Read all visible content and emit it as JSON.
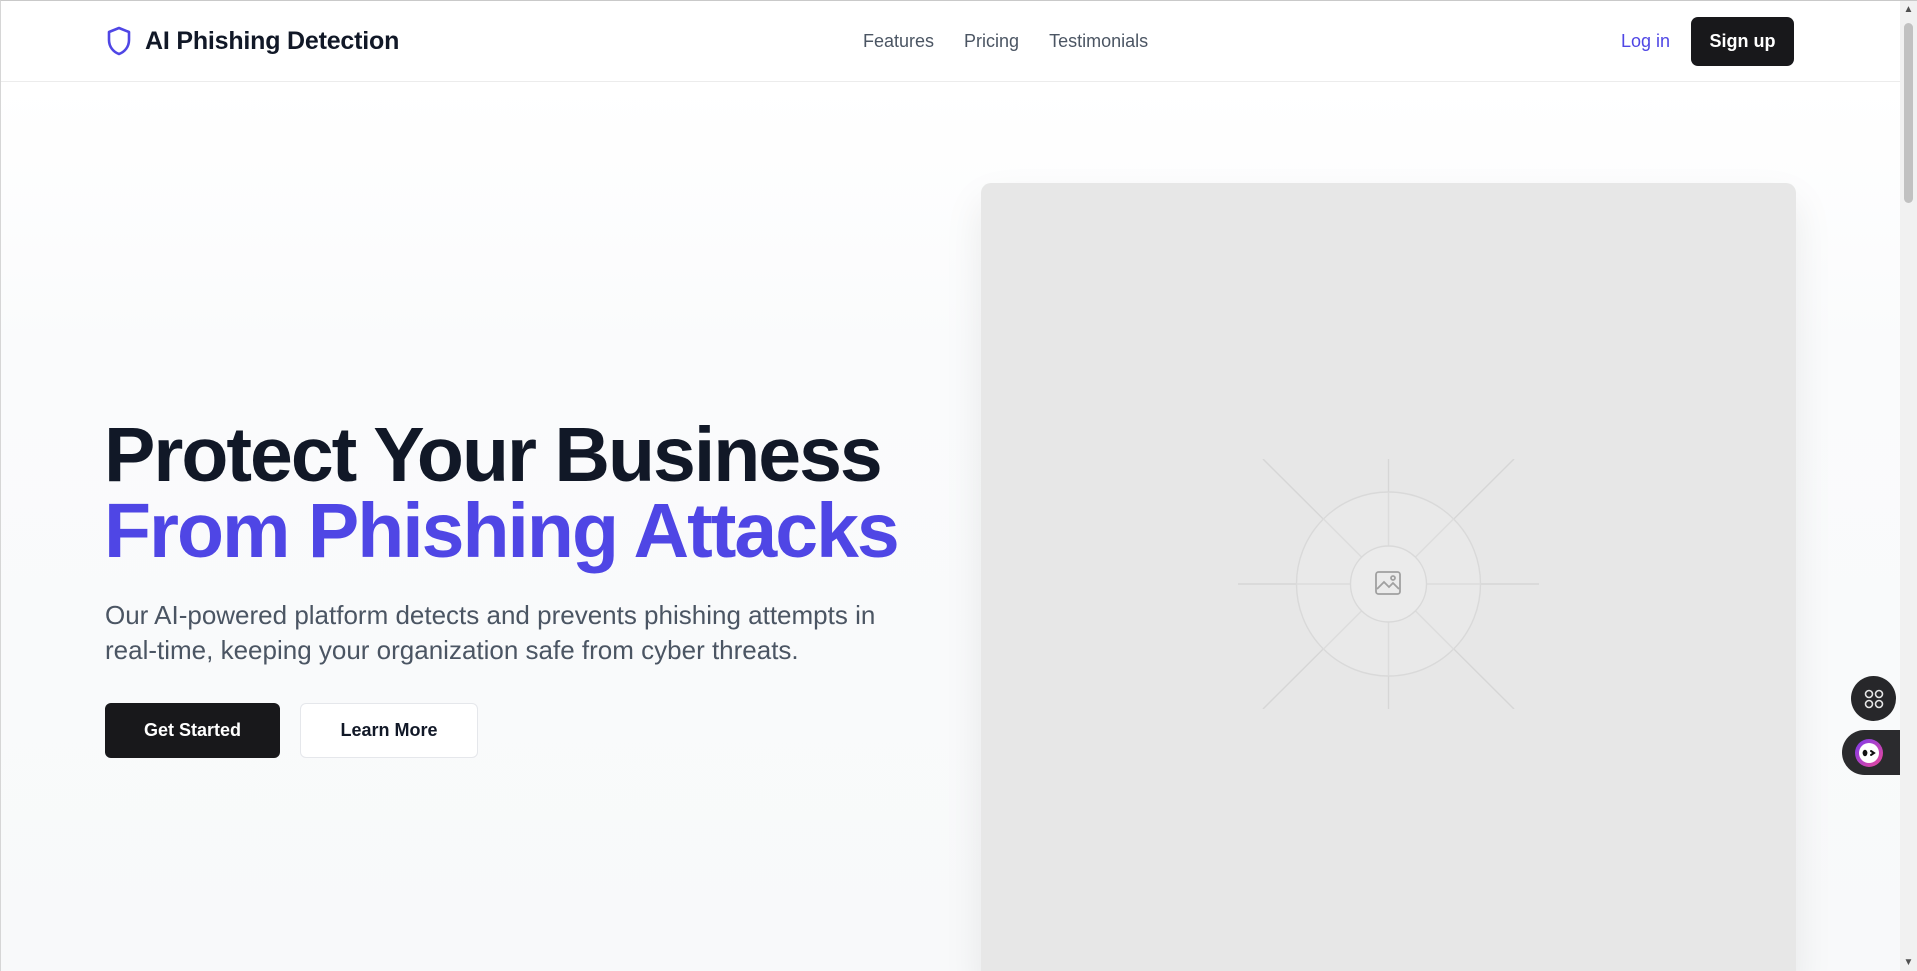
{
  "header": {
    "brand_name": "AI Phishing Detection",
    "brand_icon": "shield-icon",
    "nav": [
      {
        "label": "Features"
      },
      {
        "label": "Pricing"
      },
      {
        "label": "Testimonials"
      }
    ],
    "login_label": "Log in",
    "signup_label": "Sign up"
  },
  "hero": {
    "title_line1": "Protect Your Business",
    "title_line2": "From Phishing Attacks",
    "subtitle": "Our AI-powered platform detects and prevents phishing attempts in real-time, keeping your organization safe from cyber threats.",
    "primary_cta": "Get Started",
    "secondary_cta": "Learn More",
    "image_icon": "image-placeholder-icon"
  },
  "floating": {
    "grid_icon": "command-icon",
    "assistant_icon": "assistant-bot-icon"
  },
  "colors": {
    "accent": "#4f46e5",
    "dark_button": "#18181b",
    "heading": "#111827",
    "body_text": "#4b5563",
    "image_bg": "#e7e7e7"
  }
}
